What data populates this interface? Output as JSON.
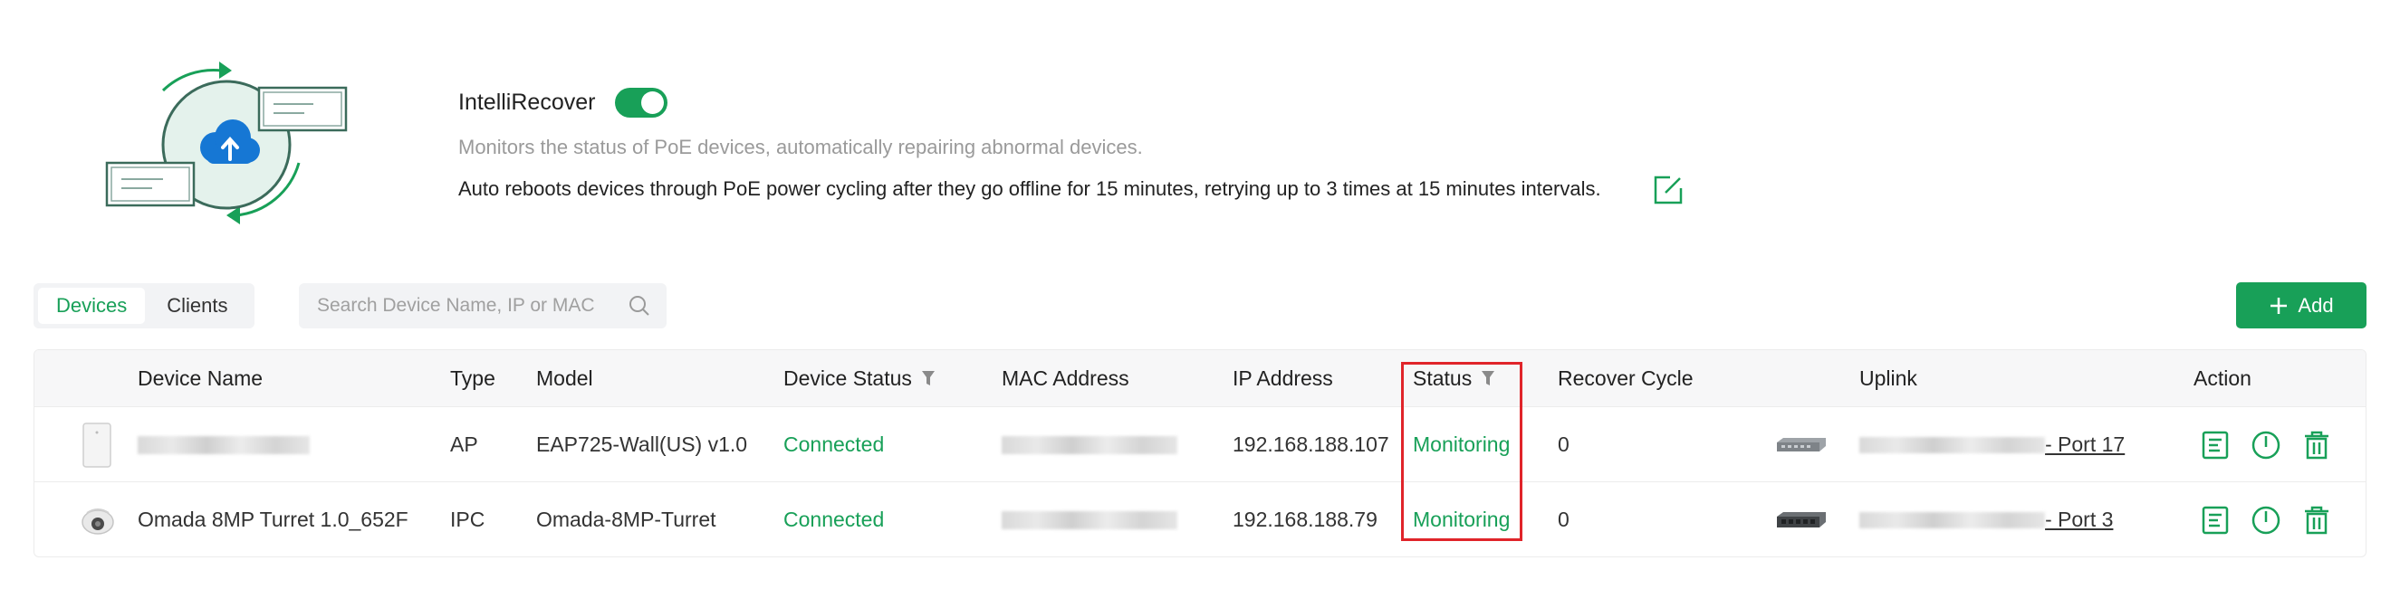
{
  "header": {
    "title": "IntelliRecover",
    "toggle_on": true,
    "description": "Monitors the status of PoE devices, automatically repairing abnormal devices.",
    "detail": "Auto reboots devices through PoE power cycling after they go offline for 15 minutes, retrying up to 3 times at 15 minutes intervals.",
    "accent_color": "#18a058"
  },
  "tabs": [
    {
      "label": "Devices",
      "active": true
    },
    {
      "label": "Clients",
      "active": false
    }
  ],
  "search": {
    "placeholder": "Search Device Name, IP or MAC"
  },
  "add_button": {
    "label": "Add"
  },
  "table": {
    "columns": {
      "device_name": "Device Name",
      "type": "Type",
      "model": "Model",
      "device_status": "Device Status",
      "mac": "MAC Address",
      "ip": "IP Address",
      "status": "Status",
      "recover_cycle": "Recover Cycle",
      "uplink": "Uplink",
      "action": "Action"
    },
    "rows": [
      {
        "device_icon": "access-point-icon",
        "device_name": "",
        "type": "AP",
        "model": "EAP725-Wall(US) v1.0",
        "device_status": "Connected",
        "mac": "",
        "ip": "192.168.188.107",
        "status": "Monitoring",
        "recover_cycle": "0",
        "uplink_icon": "switch-icon",
        "uplink_port": "- Port 17"
      },
      {
        "device_icon": "turret-camera-icon",
        "device_name": "Omada 8MP Turret 1.0_652F",
        "type": "IPC",
        "model": "Omada-8MP-Turret",
        "device_status": "Connected",
        "mac": "",
        "ip": "192.168.188.79",
        "status": "Monitoring",
        "recover_cycle": "0",
        "uplink_icon": "switch-icon",
        "uplink_port": "- Port 3"
      }
    ],
    "action_icons": [
      "log-icon",
      "power-icon",
      "delete-icon"
    ]
  },
  "highlight_color": "#e0242a"
}
